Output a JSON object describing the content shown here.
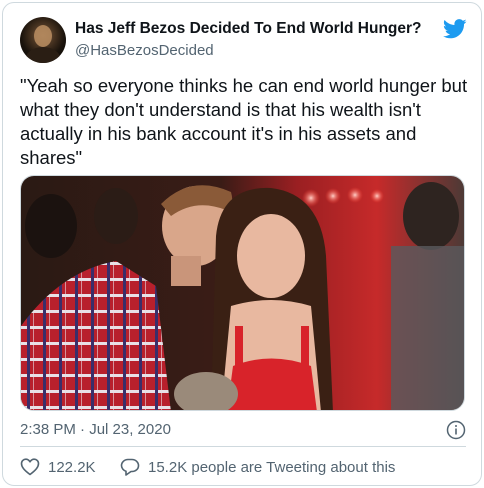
{
  "tweet": {
    "display_name": "Has Jeff Bezos Decided To End World Hunger?",
    "handle": "@HasBezosDecided",
    "text": "\"Yeah so everyone thinks he can end world hunger but what they don't understand is that his wealth isn't actually in his bank account it's in his assets and shares\"",
    "timestamp": "2:38 PM · Jul 23, 2020",
    "like_count": "122.2K",
    "reply_label": "15.2K people are Tweeting about this"
  },
  "icons": {
    "brand": "twitter-bird-icon",
    "info": "info-icon",
    "like": "heart-icon",
    "reply": "speech-bubble-icon"
  },
  "colors": {
    "brand_blue": "#1d9bf0",
    "text_primary": "#0f1419",
    "text_secondary": "#536471",
    "border": "#cfd9de"
  }
}
